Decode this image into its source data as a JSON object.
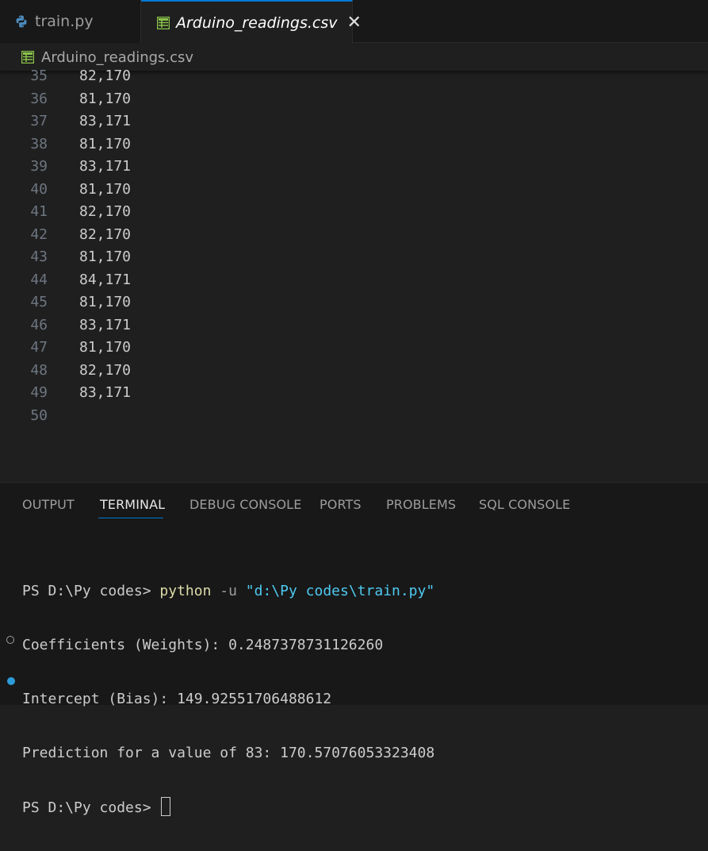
{
  "tabs": [
    {
      "label": "train.py",
      "icon": "python-icon",
      "active": false
    },
    {
      "label": "Arduino_readings.csv",
      "icon": "table-icon",
      "active": true,
      "close": "✕"
    }
  ],
  "breadcrumb": {
    "label": "Arduino_readings.csv",
    "icon": "table-icon"
  },
  "editor": {
    "lines": [
      {
        "n": "35",
        "text": "82,170"
      },
      {
        "n": "36",
        "text": "81,170"
      },
      {
        "n": "37",
        "text": "83,171"
      },
      {
        "n": "38",
        "text": "81,170"
      },
      {
        "n": "39",
        "text": "83,171"
      },
      {
        "n": "40",
        "text": "81,170"
      },
      {
        "n": "41",
        "text": "82,170"
      },
      {
        "n": "42",
        "text": "82,170"
      },
      {
        "n": "43",
        "text": "81,170"
      },
      {
        "n": "44",
        "text": "84,171"
      },
      {
        "n": "45",
        "text": "81,170"
      },
      {
        "n": "46",
        "text": "83,171"
      },
      {
        "n": "47",
        "text": "81,170"
      },
      {
        "n": "48",
        "text": "82,170"
      },
      {
        "n": "49",
        "text": "83,171"
      },
      {
        "n": "50",
        "text": ""
      }
    ]
  },
  "panel": {
    "tabs": [
      "OUTPUT",
      "TERMINAL",
      "DEBUG CONSOLE",
      "PORTS",
      "PROBLEMS",
      "SQL CONSOLE"
    ],
    "active_tab": "TERMINAL"
  },
  "terminal": {
    "prompt": "PS D:\\Py codes> ",
    "command": "python",
    "flag": " -u ",
    "arg": "\"d:\\Py codes\\train.py\"",
    "output": [
      "Coefficients (Weights): 0.2487378731126260",
      "Intercept (Bias): 149.92551706488612",
      "Prediction for a value of 83: 170.57076053323408"
    ],
    "prompt2": "PS D:\\Py codes> "
  },
  "colors": {
    "accent": "#0078d4",
    "csv_icon": "#8bc34a",
    "python_icon": "#4b8bbe",
    "terminal_dot": "#2d9bd8"
  }
}
